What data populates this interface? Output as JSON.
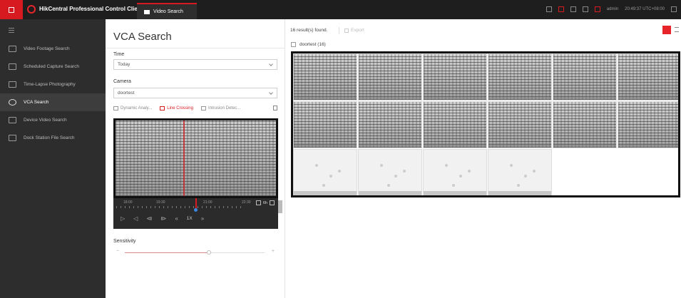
{
  "topbar": {
    "app_title": "HikCentral Professional Control Client",
    "active_tab": "Video Search",
    "user": "admin",
    "clock": "20:49:37 UTC+08:00"
  },
  "nav": {
    "items": [
      {
        "label": "Video Footage Search",
        "icon": "video-footage-icon"
      },
      {
        "label": "Scheduled Capture Search",
        "icon": "scheduled-capture-icon"
      },
      {
        "label": "Time-Lapse Photography",
        "icon": "time-lapse-icon"
      },
      {
        "label": "VCA Search",
        "icon": "vca-search-icon",
        "active": true
      },
      {
        "label": "Device Video Search",
        "icon": "device-video-icon"
      },
      {
        "label": "Dock Station File Search",
        "icon": "dock-station-icon"
      }
    ]
  },
  "panel": {
    "title": "VCA Search",
    "time_label": "Time",
    "time_value": "Today",
    "camera_label": "Camera",
    "camera_value": "doortest",
    "rule_tabs": [
      {
        "label": "Dynamic Analy...",
        "active": false
      },
      {
        "label": "Line Crossing",
        "active": true
      },
      {
        "label": "Intrusion Detec...",
        "active": false
      }
    ],
    "timeline": {
      "labels": [
        "18:00",
        "19:30",
        "21:00",
        "22:30"
      ],
      "zoom_text": "6h",
      "speed": "1X"
    },
    "sensitivity_label": "Sensitivity",
    "sensitivity_value": 0.6
  },
  "results": {
    "count_text": "16 result(s) found.",
    "export_label": "Export",
    "camera_group": "doortest (16)",
    "thumbnails": 16
  },
  "colors": {
    "accent": "#d71920",
    "nav_bg": "#2d2d2d",
    "topbar_bg": "#1e1e1e"
  }
}
